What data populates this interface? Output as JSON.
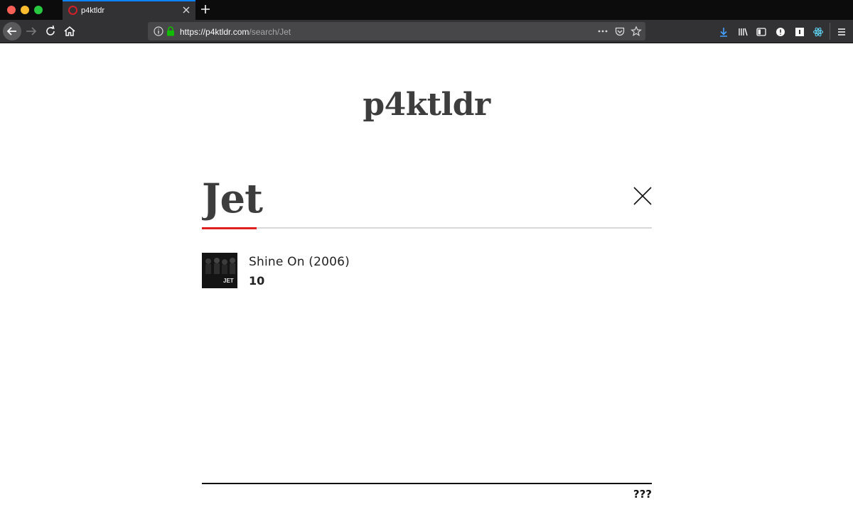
{
  "browser": {
    "tab_title": "p4ktldr",
    "url_domain": "https://p4ktldr.com",
    "url_path": "/search/Jet"
  },
  "page": {
    "logo": "p4ktldr",
    "search": {
      "value": "Jet"
    },
    "results": [
      {
        "title": "Shine On (2006)",
        "score": "10",
        "cover_text": "JET"
      }
    ],
    "footer": "???"
  },
  "colors": {
    "accent": "#e0201f",
    "text": "#3d3d3d",
    "chrome_bg": "#323234"
  },
  "icons": {
    "back": "back-arrow-icon",
    "forward": "forward-arrow-icon",
    "reload": "reload-icon",
    "home": "home-icon",
    "info": "info-icon",
    "lock": "lock-icon",
    "more": "more-dots-icon",
    "pocket": "pocket-icon",
    "bookmark": "star-icon",
    "download": "download-icon",
    "library": "library-icon",
    "sidebar": "sidebar-icon",
    "menu": "hamburger-menu-icon",
    "clear": "close-icon"
  }
}
